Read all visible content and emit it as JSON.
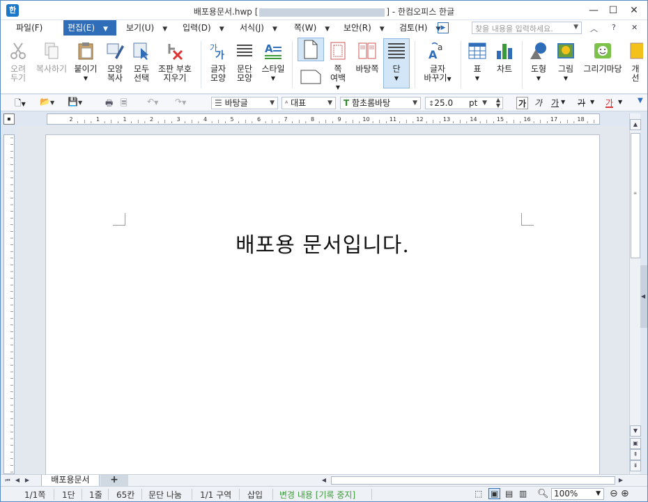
{
  "titlebar": {
    "app_icon": "hwp-icon",
    "title_prefix": "배포용문서.hwp [",
    "title_suffix": "] - 한컴오피스 한글"
  },
  "menubar": {
    "items": [
      {
        "label": "파일(F)"
      },
      {
        "label": "편집(E)",
        "active": true
      },
      {
        "label": "보기(U)"
      },
      {
        "label": "입력(D)"
      },
      {
        "label": "서식(J)"
      },
      {
        "label": "쪽(W)"
      },
      {
        "label": "보안(R)"
      },
      {
        "label": "검토(H)"
      }
    ],
    "search_placeholder": "찾을 내용을 입력하세요."
  },
  "ribbon": {
    "cut": "오려\n두기",
    "copy": "복사하기",
    "paste": "붙이기",
    "format_copy": "모양\n복사",
    "select_all": "모두\n선택",
    "clear_symbols": "조판 부호\n지우기",
    "char_shape": "글자\n모양",
    "para_shape": "문단\n모양",
    "style": "스타일",
    "page_margin": "쪽\n여백",
    "master_page": "바탕쪽",
    "column": "단",
    "change_chars": "글자\n바꾸기",
    "table": "표",
    "chart": "차트",
    "shape": "도형",
    "picture": "그림",
    "drawing_market": "그리기마당",
    "object": "개\n선"
  },
  "toolbar": {
    "style_value": "바탕글",
    "lang_value": "대표",
    "font_value": "함초롬바탕",
    "size_value": "25.0",
    "size_unit": "pt",
    "bold": "가",
    "italic": "가",
    "underline": "가",
    "strike": "가",
    "color": "가"
  },
  "ruler": {
    "h_ticks": [
      "2",
      "1",
      "1",
      "2",
      "3",
      "4",
      "5",
      "6",
      "7",
      "8",
      "9",
      "10",
      "11",
      "12",
      "13",
      "14",
      "15",
      "16",
      "17",
      "18"
    ]
  },
  "document": {
    "text": "배포용 문서입니다."
  },
  "tabs": {
    "doc_tab": "배포용문서",
    "add_tab": "+"
  },
  "statusbar": {
    "page": "1/1쪽",
    "column": "1단",
    "line": "1줄",
    "col": "65칸",
    "para_split": "문단 나눔",
    "section": "1/1 구역",
    "insert": "삽입",
    "track_changes": "변경 내용 [기록 중지]",
    "zoom": "100%",
    "track_color": "#3a9a3a"
  }
}
